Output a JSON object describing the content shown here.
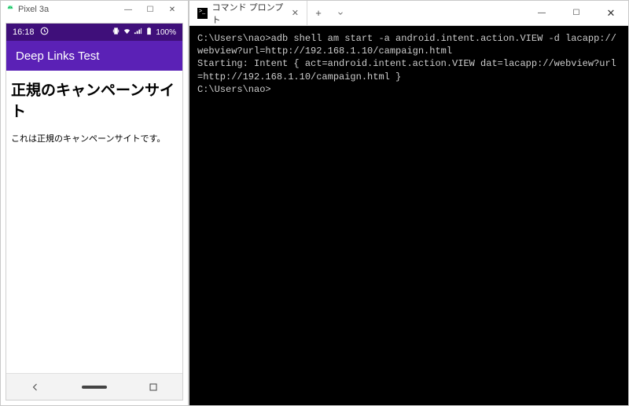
{
  "emulator": {
    "window_title": "Pixel 3a",
    "statusbar": {
      "time": "16:18",
      "battery": "100%"
    },
    "appbar_title": "Deep Links Test",
    "page": {
      "heading": "正規のキャンペーンサイト",
      "paragraph": "これは正規のキャンペーンサイトです。"
    }
  },
  "terminal": {
    "tab_title": "コマンド プロンプト",
    "lines": {
      "prompt1": "C:\\Users\\nao>",
      "cmd1": "adb shell am start -a android.intent.action.VIEW -d lacapp://webview?url=http://192.168.1.10/campaign.html",
      "output1": "Starting: Intent { act=android.intent.action.VIEW dat=lacapp://webview?url=http://192.168.1.10/campaign.html }",
      "prompt2": "C:\\Users\\nao>"
    }
  }
}
